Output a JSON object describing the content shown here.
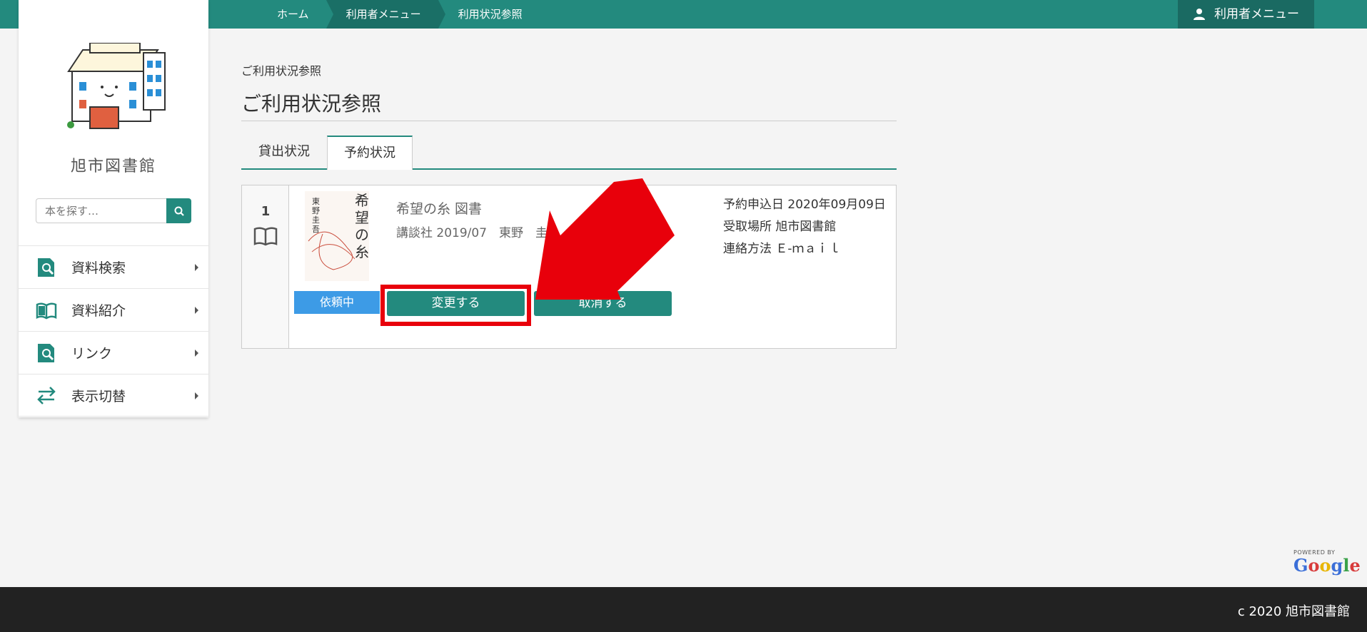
{
  "breadcrumbs": [
    {
      "label": "ホーム"
    },
    {
      "label": "利用者メニュー"
    },
    {
      "label": "利用状況参照"
    }
  ],
  "user_menu": {
    "label": "利用者メニュー",
    "icon": "user-icon"
  },
  "sidebar": {
    "library_name": "旭市図書館",
    "search_placeholder": "本を探す…",
    "items": [
      {
        "label": "資料検索",
        "icon": "search-doc-icon"
      },
      {
        "label": "資料紹介",
        "icon": "open-book-icon"
      },
      {
        "label": "リンク",
        "icon": "search-doc-icon"
      },
      {
        "label": "表示切替",
        "icon": "swap-arrows-icon"
      }
    ]
  },
  "main": {
    "breadcrumb_small": "ご利用状況参照",
    "title": "ご利用状況参照",
    "tabs": [
      {
        "label": "貸出状況",
        "active": false
      },
      {
        "label": "予約状況",
        "active": true
      }
    ],
    "reservation": {
      "index": "1",
      "book_title": "希望の糸 図書",
      "meta": "講談社 2019/07　東野　圭",
      "cover_title": "希望の糸",
      "cover_author": "東野圭吾",
      "info": [
        "予約申込日 2020年09月09日",
        "受取場所 旭市図書館",
        "連絡方法 Ｅ-ｍａｉｌ"
      ],
      "status": "依頼中",
      "change_label": "変更する",
      "cancel_label": "取消する"
    }
  },
  "google": {
    "powered": "POWERED BY",
    "logo": "Google"
  },
  "footer": {
    "copyright": "c 2020 旭市図書館"
  },
  "colors": {
    "accent": "#238a7e",
    "status_blue": "#3d9be6",
    "annotation_red": "#e8000b"
  }
}
